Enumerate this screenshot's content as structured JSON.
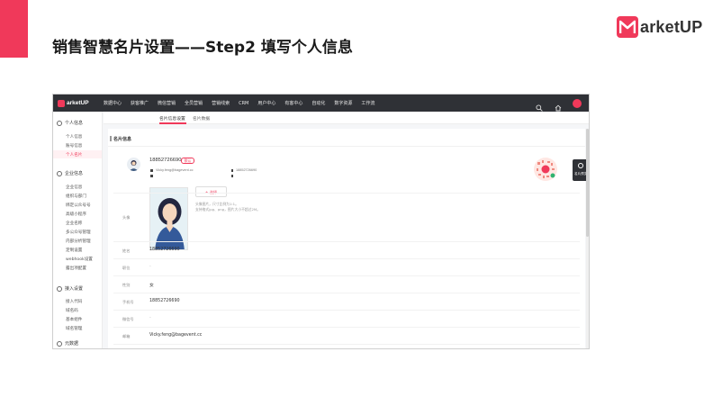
{
  "slide": {
    "title": "销售智慧名片设置——Step2 填写个人信息",
    "logo_text": "arketUP",
    "accent_color": "#f0395a"
  },
  "app": {
    "brand": "arketUP",
    "nav": [
      "数据中心",
      "获客推广",
      "微信营销",
      "全员营销",
      "营销线索",
      "CRM",
      "用户中心",
      "有客中心",
      "自动化",
      "数字资源",
      "工作流"
    ],
    "right_icons": [
      "search-icon",
      "home-icon",
      "avatar"
    ]
  },
  "sidebar": {
    "groups": [
      {
        "label": "个人信息",
        "items": [
          "个人信息",
          "账号信息",
          "个人名片"
        ]
      },
      {
        "label": "企业信息",
        "items": [
          "企业信息",
          "组织与部门",
          "绑定公众号号",
          "高级小程序",
          "企业名称",
          "多公众号管理",
          "内部分析管理",
          "定制设置",
          "webhook设置",
          "露出项配置"
        ]
      },
      {
        "label": "接入设置",
        "items": [
          "接入代码",
          "域名码",
          "基本组件",
          "域名管理"
        ]
      },
      {
        "label": "元数据",
        "items": []
      }
    ],
    "active_item": "个人名片"
  },
  "tabs": [
    "名片信息设置",
    "名片数据"
  ],
  "card": {
    "section_title": "名片信息",
    "name": "18852726690",
    "badge": "默认",
    "email": "Vicky.feng@bagevent.cc",
    "phone": "18852726690"
  },
  "float_button": "名片预览",
  "form": {
    "rows": [
      {
        "label": "头像",
        "value": ""
      },
      {
        "label": "姓名",
        "value": "18852726690"
      },
      {
        "label": "职位",
        "value": "-"
      },
      {
        "label": "性别",
        "value": "女"
      },
      {
        "label": "手机号",
        "value": "18852726690"
      },
      {
        "label": "微信号",
        "value": "-"
      },
      {
        "label": "邮箱",
        "value": "Vicky.feng@bagevent.cc"
      }
    ],
    "upload_label": "+ 选择",
    "upload_hint_1": "头像图片，尺寸比例为1:1。",
    "upload_hint_2": "支持格式jpg、png，图片大小不超过2M。"
  }
}
